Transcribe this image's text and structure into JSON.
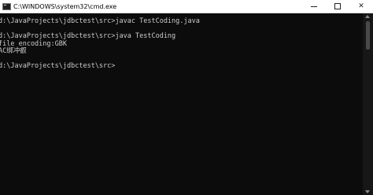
{
  "window": {
    "title": "C:\\WINDOWS\\system32\\cmd.exe",
    "minimize_icon": "minimize-icon",
    "maximize_icon": "maximize-icon",
    "close_glyph": "✕"
  },
  "console": {
    "background": "#0c0c0c",
    "text_color": "#cccccc",
    "lines": [
      "d:\\JavaProjects\\jdbctest\\src>javac TestCoding.java",
      "",
      "d:\\JavaProjects\\jdbctest\\src>java TestCoding",
      "file encoding:GBK",
      "AC绑冲叡",
      "",
      "d:\\JavaProjects\\jdbctest\\src>"
    ]
  },
  "scrollbar": {
    "up_icon": "scroll-up-icon",
    "down_icon": "scroll-down-icon"
  }
}
